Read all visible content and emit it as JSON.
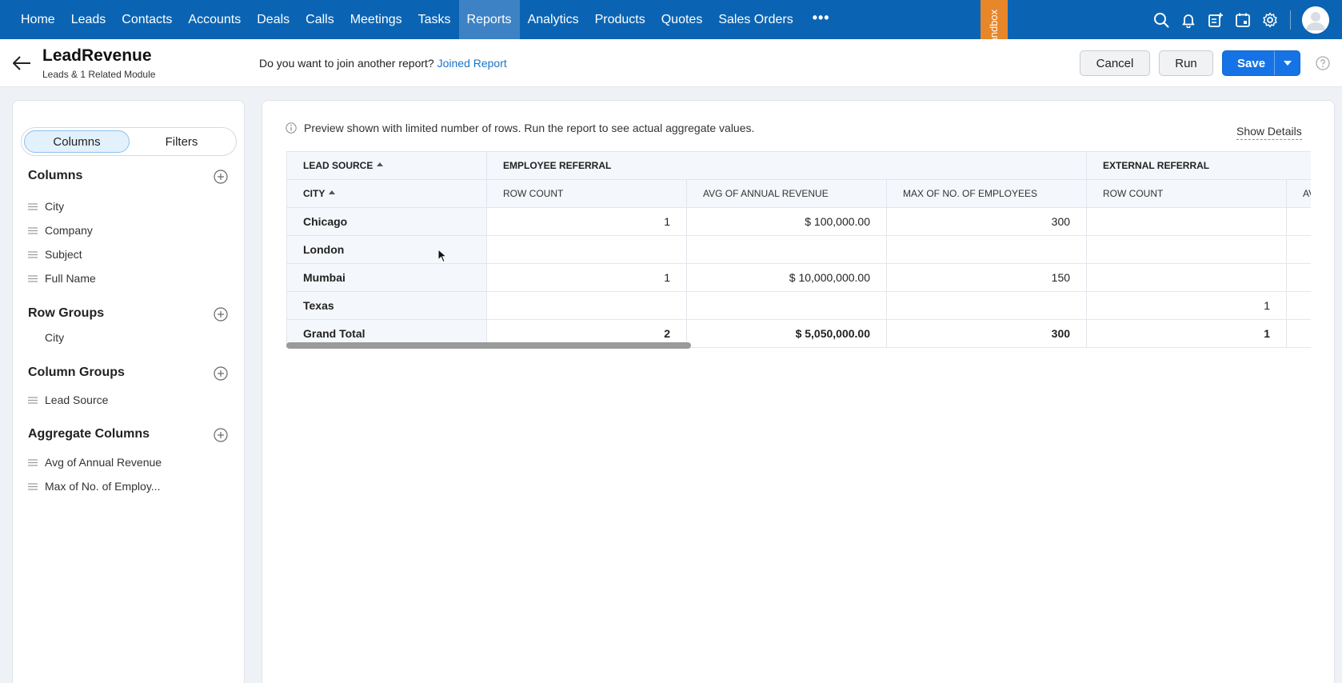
{
  "nav": {
    "items": [
      "Home",
      "Leads",
      "Contacts",
      "Accounts",
      "Deals",
      "Calls",
      "Meetings",
      "Tasks",
      "Reports",
      "Analytics",
      "Products",
      "Quotes",
      "Sales Orders"
    ],
    "active": "Reports",
    "more_glyph": "•••",
    "sandbox_label": "Sandbox",
    "bg_color": "#0b64b3",
    "ribbon_color": "#e8862a",
    "icons": [
      "search-icon",
      "bell-icon",
      "add-note-icon",
      "calendar-icon",
      "gear-icon"
    ]
  },
  "header": {
    "title": "LeadRevenue",
    "subtitle": "Leads & 1 Related Module",
    "join_question": "Do you want to join another report?",
    "join_link": "Joined Report",
    "cancel_label": "Cancel",
    "run_label": "Run",
    "save_label": "Save"
  },
  "left_panel": {
    "tabs": {
      "columns": "Columns",
      "filters": "Filters"
    },
    "columns_title": "Columns",
    "columns": [
      "City",
      "Company",
      "Subject",
      "Full Name"
    ],
    "row_groups_title": "Row Groups",
    "row_groups": [
      "City"
    ],
    "column_groups_title": "Column Groups",
    "column_groups": [
      "Lead Source"
    ],
    "aggregate_title": "Aggregate Columns",
    "aggregates": [
      "Avg of Annual Revenue",
      "Max of No. of Employ..."
    ]
  },
  "main": {
    "info_text": "Preview shown with limited number of rows. Run the report to see actual aggregate values.",
    "show_details": "Show Details",
    "table": {
      "lead_source_header": "LEAD SOURCE",
      "city_header": "CITY",
      "groups": [
        "EMPLOYEE REFERRAL",
        "EXTERNAL REFERRAL"
      ],
      "sub_headers": [
        "ROW COUNT",
        "AVG OF ANNUAL REVENUE",
        "MAX OF NO. OF EMPLOYEES",
        "ROW COUNT",
        "AV"
      ],
      "rows": [
        {
          "city": "Chicago",
          "c1": "1",
          "c2": "$ 100,000.00",
          "c3": "300",
          "c4": "",
          "c5": ""
        },
        {
          "city": "London",
          "c1": "",
          "c2": "",
          "c3": "",
          "c4": "",
          "c5": ""
        },
        {
          "city": "Mumbai",
          "c1": "1",
          "c2": "$ 10,000,000.00",
          "c3": "150",
          "c4": "",
          "c5": ""
        },
        {
          "city": "Texas",
          "c1": "",
          "c2": "",
          "c3": "",
          "c4": "1",
          "c5": ""
        }
      ],
      "grand_total": {
        "city": "Grand Total",
        "c1": "2",
        "c2": "$ 5,050,000.00",
        "c3": "300",
        "c4": "1",
        "c5": ""
      }
    }
  }
}
